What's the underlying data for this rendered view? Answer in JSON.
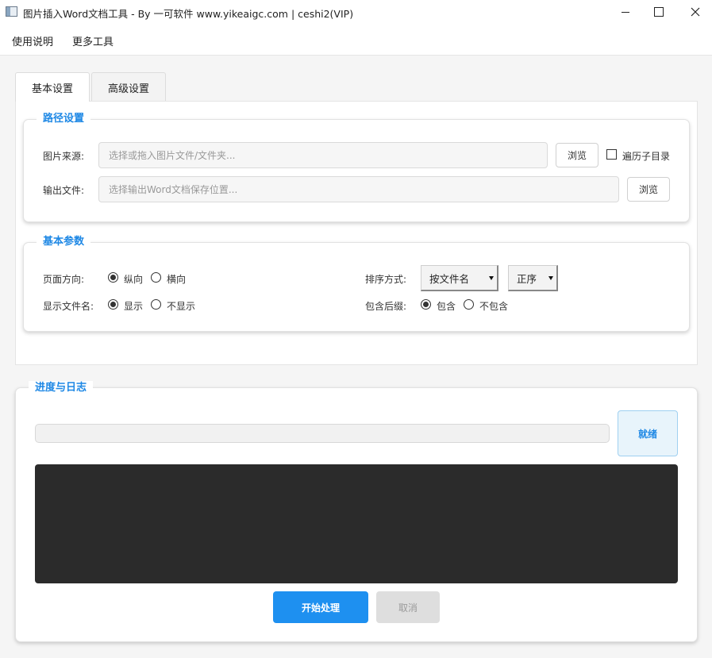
{
  "window": {
    "title": "图片插入Word文档工具 - By 一可软件 www.yikeaigc.com | ceshi2(VIP)"
  },
  "menu": {
    "help": "使用说明",
    "more_tools": "更多工具"
  },
  "tabs": [
    {
      "label": "基本设置",
      "active": true
    },
    {
      "label": "高级设置",
      "active": false
    }
  ],
  "path_settings": {
    "title": "路径设置",
    "source_label": "图片来源:",
    "source_placeholder": "选择或拖入图片文件/文件夹...",
    "source_browse": "浏览",
    "recurse_label": "遍历子目录",
    "recurse_checked": false,
    "output_label": "输出文件:",
    "output_placeholder": "选择输出Word文档保存位置...",
    "output_browse": "浏览"
  },
  "basic_params": {
    "title": "基本参数",
    "orientation_label": "页面方向:",
    "portrait": "纵向",
    "landscape": "横向",
    "orientation_value": "纵向",
    "show_filename_label": "显示文件名:",
    "show": "显示",
    "hide": "不显示",
    "show_filename_value": "显示",
    "sort_label": "排序方式:",
    "sort_by": "按文件名",
    "sort_order": "正序",
    "extension_label": "包含后缀:",
    "include": "包含",
    "exclude": "不包含",
    "extension_value": "包含"
  },
  "progress_log": {
    "title": "进度与日志",
    "progress": 0,
    "status": "就绪"
  },
  "actions": {
    "start": "开始处理",
    "cancel": "取消"
  },
  "colors": {
    "accent": "#1e88e5",
    "log_background": "#2b2b2b",
    "start_button": "#1e90f0",
    "disabled_button": "#dedede"
  }
}
